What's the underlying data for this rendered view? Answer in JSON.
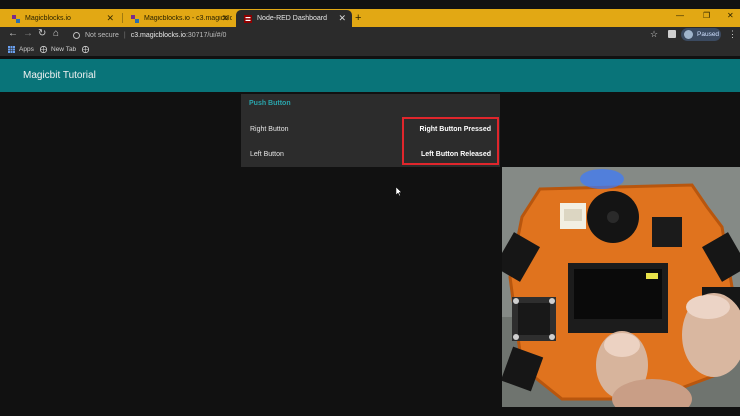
{
  "browser": {
    "tabs": [
      {
        "title": "Magicblocks.io",
        "active": false
      },
      {
        "title": "Magicblocks.io - c3.magicblocks.io",
        "active": false
      },
      {
        "title": "Node-RED Dashboard",
        "active": true
      }
    ],
    "address": {
      "security": "Not secure",
      "domain": "c3.magicblocks.io",
      "path": ":30717/ui/#/0"
    },
    "profile_status": "Paused",
    "bookmarks": [
      {
        "label": "Apps"
      },
      {
        "label": "New Tab"
      },
      {
        "label": ""
      }
    ]
  },
  "dashboard": {
    "title": "Magicbit Tutorial",
    "group": {
      "title": "Push Button",
      "rows": [
        {
          "label": "Right Button",
          "value": "Right Button Pressed"
        },
        {
          "label": "Left Button",
          "value": "Left Button Released"
        }
      ]
    }
  },
  "colors": {
    "accent": "#097479",
    "group_title": "#2aa4ab",
    "highlight_box": "#e0262c",
    "tabstrip": "#e2a814"
  }
}
